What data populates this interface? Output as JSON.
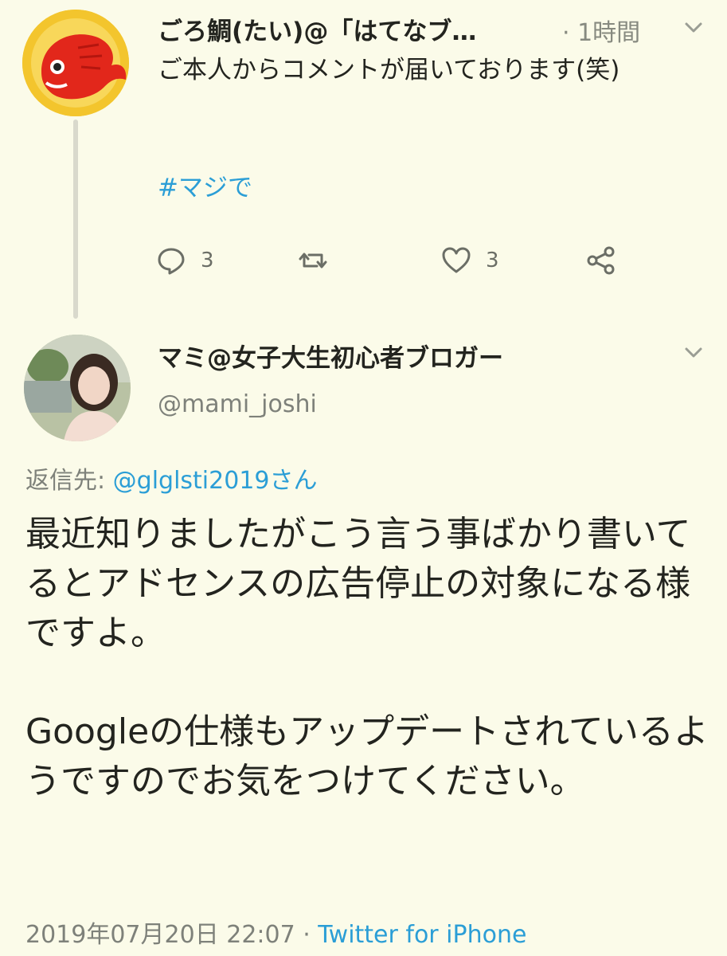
{
  "tweet1": {
    "display_name": "ごろ鯛(たい)@「はてなブ…",
    "time": "· 1時間",
    "text": "ご本人からコメントが届いております(笑)",
    "hashtag": "#マジで",
    "reply_count": "3",
    "like_count": "3",
    "avatar_icon": "red-fish-avatar"
  },
  "tweet2": {
    "display_name": "マミ@女子大生初心者ブロガー",
    "handle": "@mami_joshi",
    "reply_prefix": "返信先: ",
    "reply_to": "@glglsti2019さん",
    "text": "最近知りましたがこう言う事ばかり書いてるとアドセンスの広告停止の対象になる様ですよ。\n\nGoogleの仕様もアップデートされているようですのでお気をつけてください。",
    "timestamp": "2019年07月20日 22:07 · ",
    "client": "Twitter for iPhone",
    "avatar_icon": "user-photo-avatar"
  },
  "colors": {
    "background": "#fbfbe9",
    "link": "#2b9ed6",
    "secondary_text": "#7e817a"
  }
}
